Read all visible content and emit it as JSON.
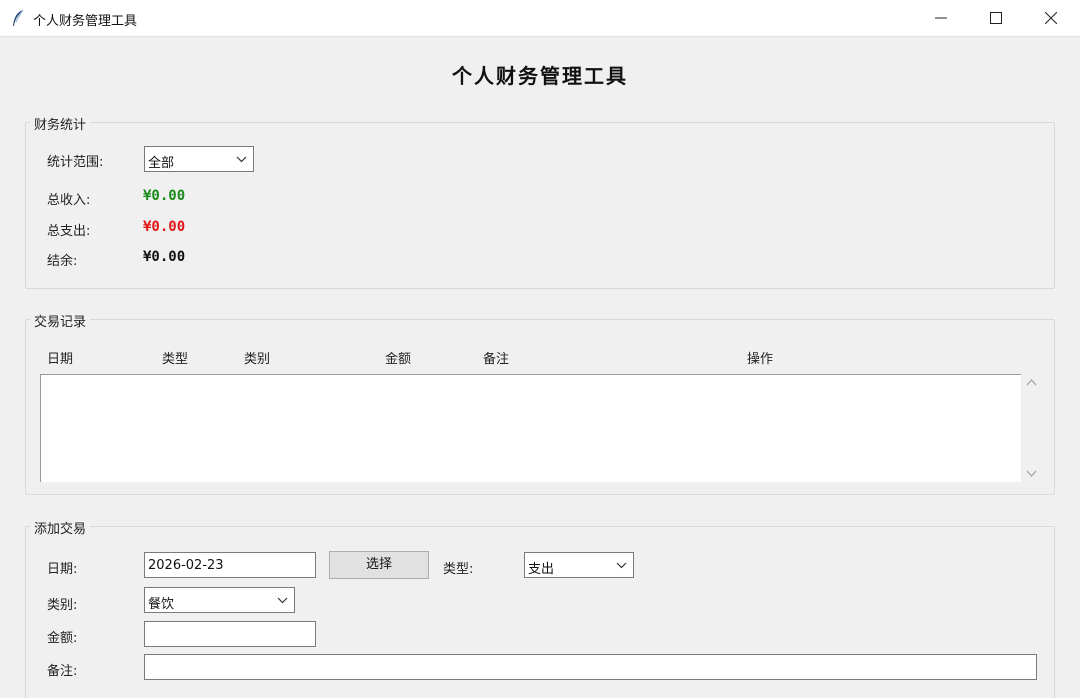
{
  "window": {
    "title": "个人财务管理工具",
    "icon": "feather-icon"
  },
  "app": {
    "title": "个人财务管理工具"
  },
  "stats": {
    "legend": "财务统计",
    "range_label": "统计范围:",
    "range_value": "全部",
    "income_label": "总收入:",
    "income_value": "¥0.00",
    "expense_label": "总支出:",
    "expense_value": "¥0.00",
    "balance_label": "结余:",
    "balance_value": "¥0.00",
    "colors": {
      "income": "#1a8a1a",
      "expense": "#e01515",
      "balance": "#111111"
    }
  },
  "records": {
    "legend": "交易记录",
    "columns": [
      "日期",
      "类型",
      "类别",
      "金额",
      "备注",
      "操作"
    ],
    "rows": []
  },
  "add": {
    "legend": "添加交易",
    "date_label": "日期:",
    "date_value": "2026-02-23",
    "select_button": "选择",
    "type_label": "类型:",
    "type_value": "支出",
    "category_label": "类别:",
    "category_value": "餐饮",
    "amount_label": "金额:",
    "amount_value": "",
    "note_label": "备注:",
    "note_value": ""
  }
}
